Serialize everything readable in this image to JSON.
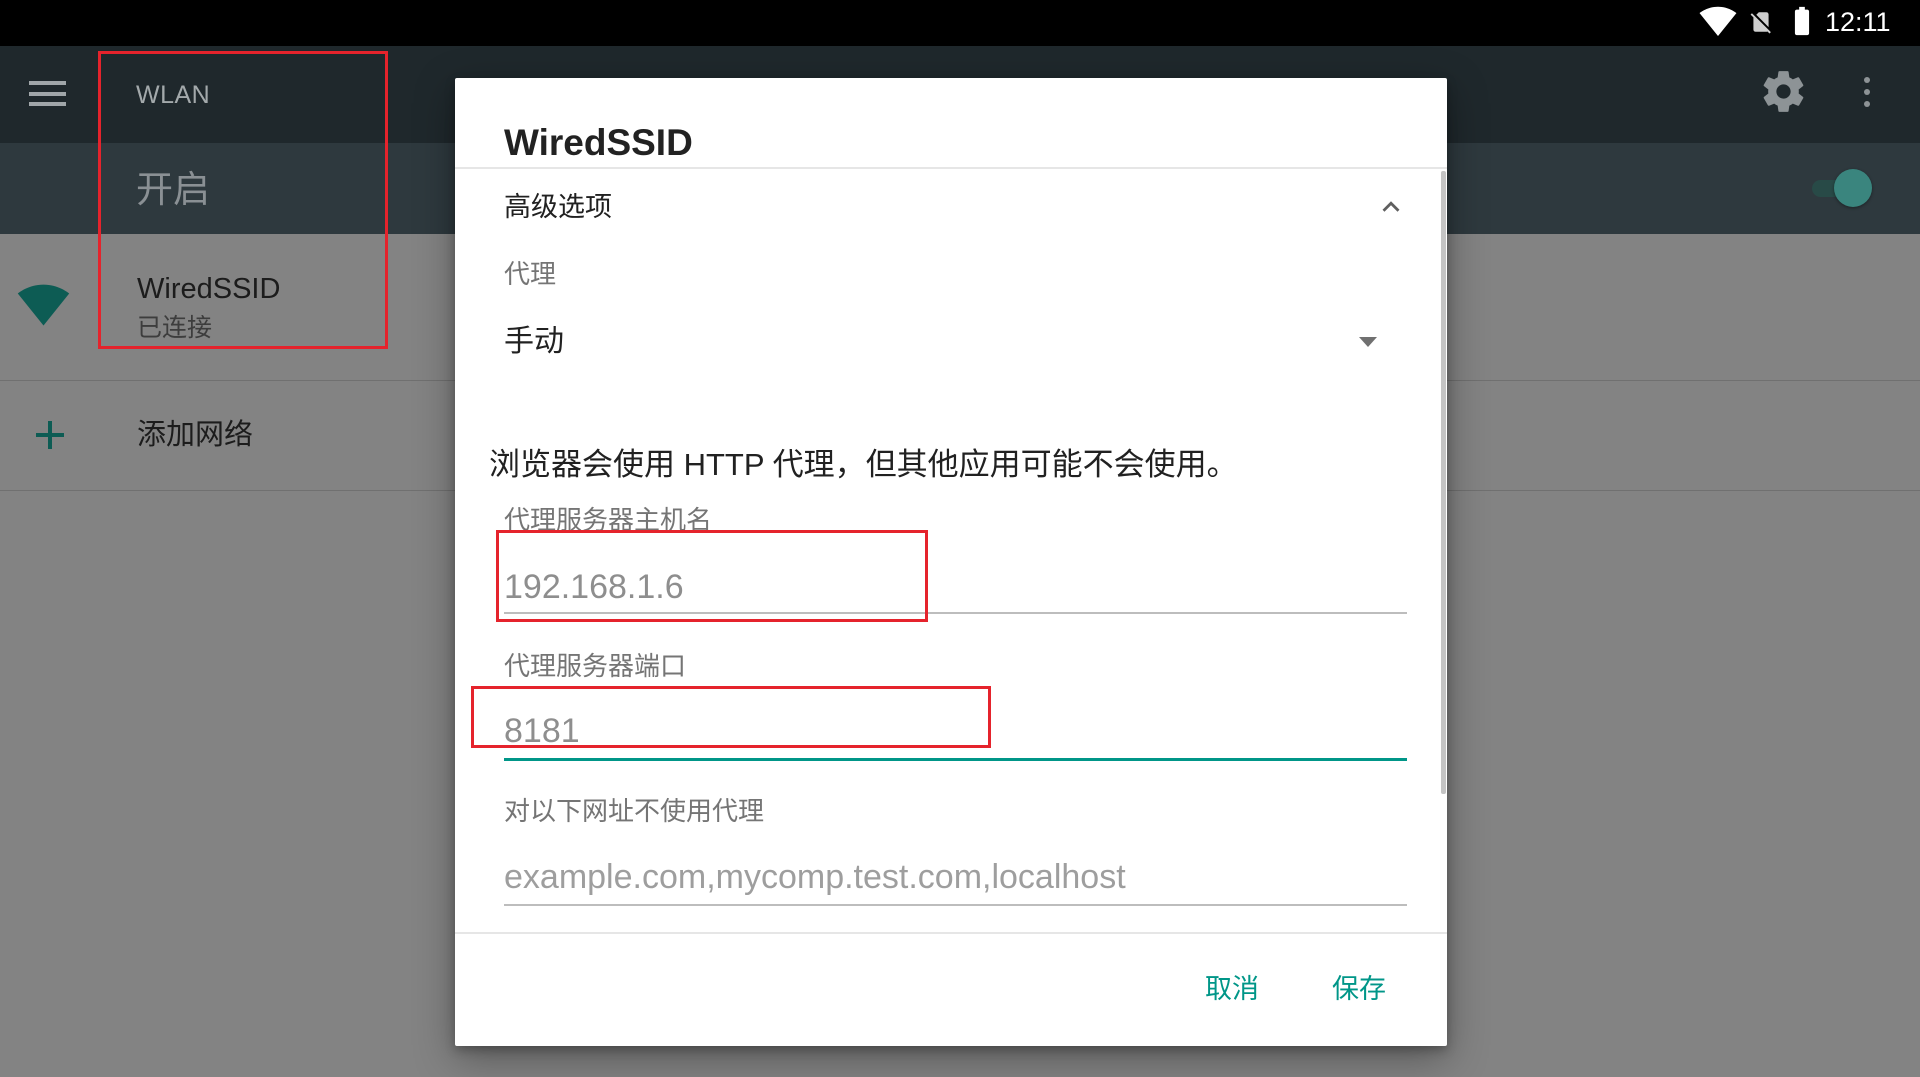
{
  "status_bar": {
    "time": "12:11",
    "icons": [
      "wifi-signal-icon",
      "no-sim-icon",
      "battery-icon"
    ]
  },
  "toolbar": {
    "title": "WLAN",
    "menu_icon": "menu-icon",
    "settings_icon": "gear-icon",
    "overflow_icon": "more-vert-icon"
  },
  "switch_bar": {
    "label": "开启",
    "toggle_on": true
  },
  "networks": [
    {
      "ssid": "WiredSSID",
      "status": "已连接",
      "icon": "wifi-icon"
    }
  ],
  "add_network": {
    "label": "添加网络",
    "icon": "plus-icon"
  },
  "dialog": {
    "title": "WiredSSID",
    "advanced_label": "高级选项",
    "advanced_icon": "chevron-up-icon",
    "proxy_label": "代理",
    "proxy_value": "手动",
    "proxy_note": "浏览器会使用 HTTP 代理，但其他应用可能不会使用。",
    "host_label": "代理服务器主机名",
    "host_value": "192.168.1.6",
    "port_label": "代理服务器端口",
    "port_value": "8181",
    "bypass_label": "对以下网址不使用代理",
    "bypass_placeholder": "example.com,mycomp.test.com,localhost",
    "cancel_label": "取消",
    "save_label": "保存"
  },
  "colors": {
    "accent": "#009688",
    "annotation": "#e5232c"
  }
}
